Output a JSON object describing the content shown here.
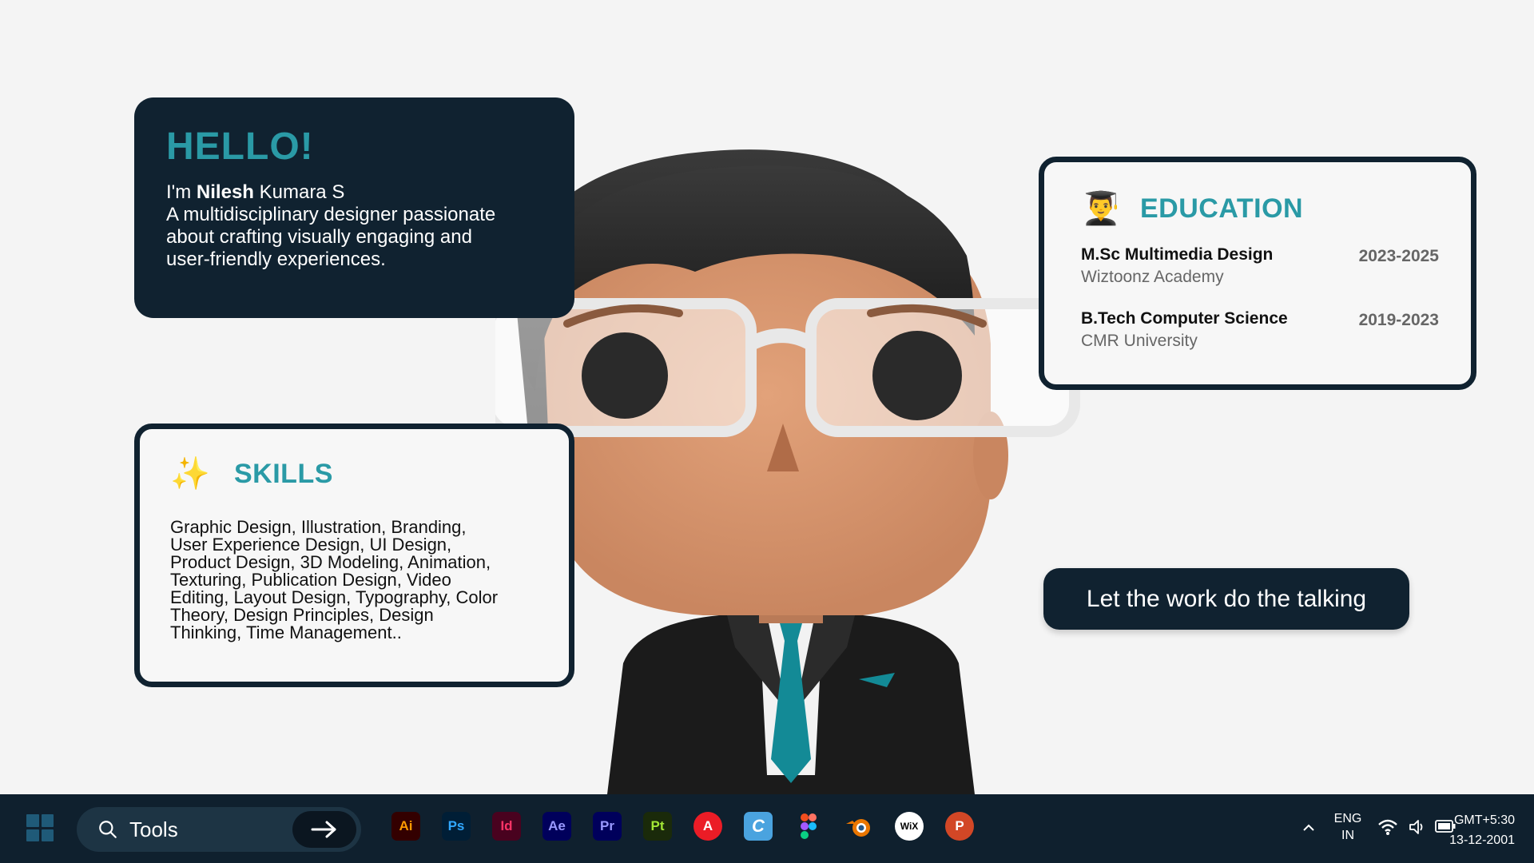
{
  "hello": {
    "title": "HELLO!",
    "greeting_prefix": "I'm ",
    "first_name": "Nilesh",
    "last_name": " Kumara S",
    "bio": "A multidisciplinary designer passionate about crafting visually engaging and user-friendly experiences."
  },
  "skills": {
    "icon": "✨",
    "icon_name": "sparkles-icon",
    "title": "SKILLS",
    "text": "Graphic Design, Illustration, Branding, User Experience Design, UI Design, Product Design, 3D Modeling, Animation, Texturing, Publication Design, Video Editing, Layout Design, Typography, Color Theory, Design Principles, Design Thinking, Time Management.."
  },
  "education": {
    "icon": "👨‍🎓",
    "icon_name": "graduate-icon",
    "title": "EDUCATION",
    "entries": [
      {
        "degree": "M.Sc Multimedia Design",
        "school": "Wiztoonz Academy",
        "years": "2023-2025"
      },
      {
        "degree": "B.Tech Computer Science",
        "school": "CMR University",
        "years": "2019-2023"
      }
    ]
  },
  "tagline": "Let the work do the talking",
  "taskbar": {
    "search_label": "Tools",
    "apps": [
      {
        "label": "Ai",
        "name": "illustrator-icon",
        "bg": "#330000",
        "fg": "#ff9a00"
      },
      {
        "label": "Ps",
        "name": "photoshop-icon",
        "bg": "#001e36",
        "fg": "#31a8ff"
      },
      {
        "label": "Id",
        "name": "indesign-icon",
        "bg": "#49021f",
        "fg": "#ff3366"
      },
      {
        "label": "Ae",
        "name": "after-effects-icon",
        "bg": "#00005b",
        "fg": "#9999ff"
      },
      {
        "label": "Pr",
        "name": "premiere-pro-icon",
        "bg": "#00005b",
        "fg": "#9999ff"
      },
      {
        "label": "Pt",
        "name": "substance-painter-icon",
        "bg": "#1a2a0a",
        "fg": "#a3e635"
      },
      {
        "label": "A",
        "name": "adobe-express-icon",
        "bg": "#eb1c26",
        "fg": "#ffffff"
      },
      {
        "label": "C",
        "name": "canva-icon",
        "bg": "#4aa3df",
        "fg": "#ffffff"
      },
      {
        "label": "",
        "name": "figma-icon",
        "bg": "transparent",
        "fg": "#ffffff"
      },
      {
        "label": "",
        "name": "blender-icon",
        "bg": "transparent",
        "fg": "#ffffff"
      },
      {
        "label": "WiX",
        "name": "wix-icon",
        "bg": "#ffffff",
        "fg": "#000000"
      },
      {
        "label": "P",
        "name": "powerpoint-icon",
        "bg": "#d24726",
        "fg": "#ffffff"
      }
    ],
    "lang_line1": "ENG",
    "lang_line2": "IN",
    "timezone": "GMT+5:30",
    "date": "13-12-2001"
  },
  "colors": {
    "accent": "#2a9aa6",
    "dark_panel": "#102230",
    "background": "#f4f4f4"
  }
}
